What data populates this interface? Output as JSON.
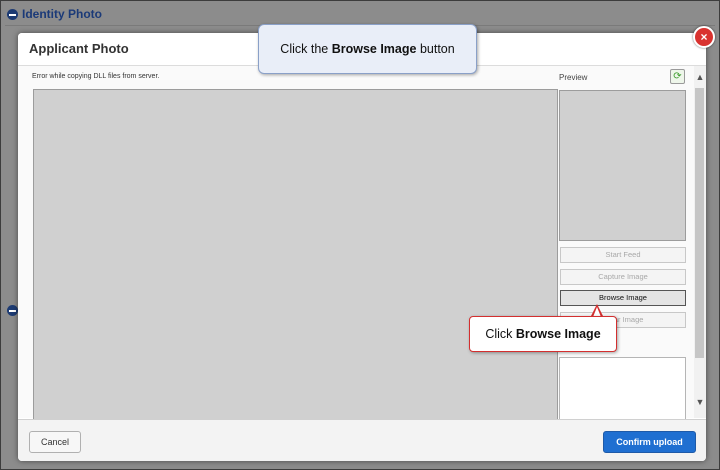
{
  "background": {
    "section_title": "Identity Photo"
  },
  "modal": {
    "title": "Applicant Photo",
    "error_message": "Error while copying DLL files from server.",
    "preview_label": "Preview",
    "buttons": {
      "start_feed": "Start Feed",
      "capture_image": "Capture Image",
      "browse_image": "Browse Image",
      "clear_image": "Clear Image"
    },
    "footer": {
      "cancel": "Cancel",
      "confirm": "Confirm upload"
    }
  },
  "callouts": {
    "top_prefix": "Click the ",
    "top_bold": "Browse Image",
    "top_suffix": " button",
    "bottom_prefix": "Click ",
    "bottom_bold": "Browse Image"
  },
  "colors": {
    "accent": "#1f6fd1",
    "close": "#d9322f",
    "callout_border": "#d32f2f"
  }
}
